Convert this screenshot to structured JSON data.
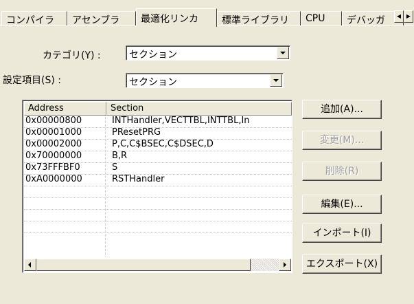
{
  "tabs": [
    {
      "label": "コンパイラ",
      "active": false
    },
    {
      "label": "アセンブラ",
      "active": false
    },
    {
      "label": "最適化リンカ",
      "active": true
    },
    {
      "label": "標準ライブラリ",
      "active": false
    },
    {
      "label": "CPU",
      "active": false
    },
    {
      "label": "デバッガ",
      "active": false
    }
  ],
  "tab_scroll": {
    "left_icon": "left-arrow-icon",
    "right_icon": "right-arrow-icon"
  },
  "category": {
    "label": "カテゴリ(Y) :",
    "value": "セクション"
  },
  "setting_item": {
    "label": "設定項目(S) :",
    "value": "セクション"
  },
  "table": {
    "columns": [
      "Address",
      "Section"
    ],
    "rows": [
      [
        "0x00000800",
        "INTHandler,VECTTBL,INTTBL,In"
      ],
      [
        "0x00001000",
        "PResetPRG"
      ],
      [
        "0x00002000",
        "P,C,C$BSEC,C$DSEC,D"
      ],
      [
        "0x70000000",
        "B,R"
      ],
      [
        "0x73FFFBF0",
        "S"
      ],
      [
        "0xA0000000",
        "RSTHandler"
      ]
    ],
    "empty_rows": 4
  },
  "buttons": {
    "add": "追加(A)...",
    "change": "変更(M)...",
    "delete": "削除(R)",
    "edit": "編集(E)...",
    "import": "インポート(I)",
    "export": "エクスポート(X)"
  }
}
